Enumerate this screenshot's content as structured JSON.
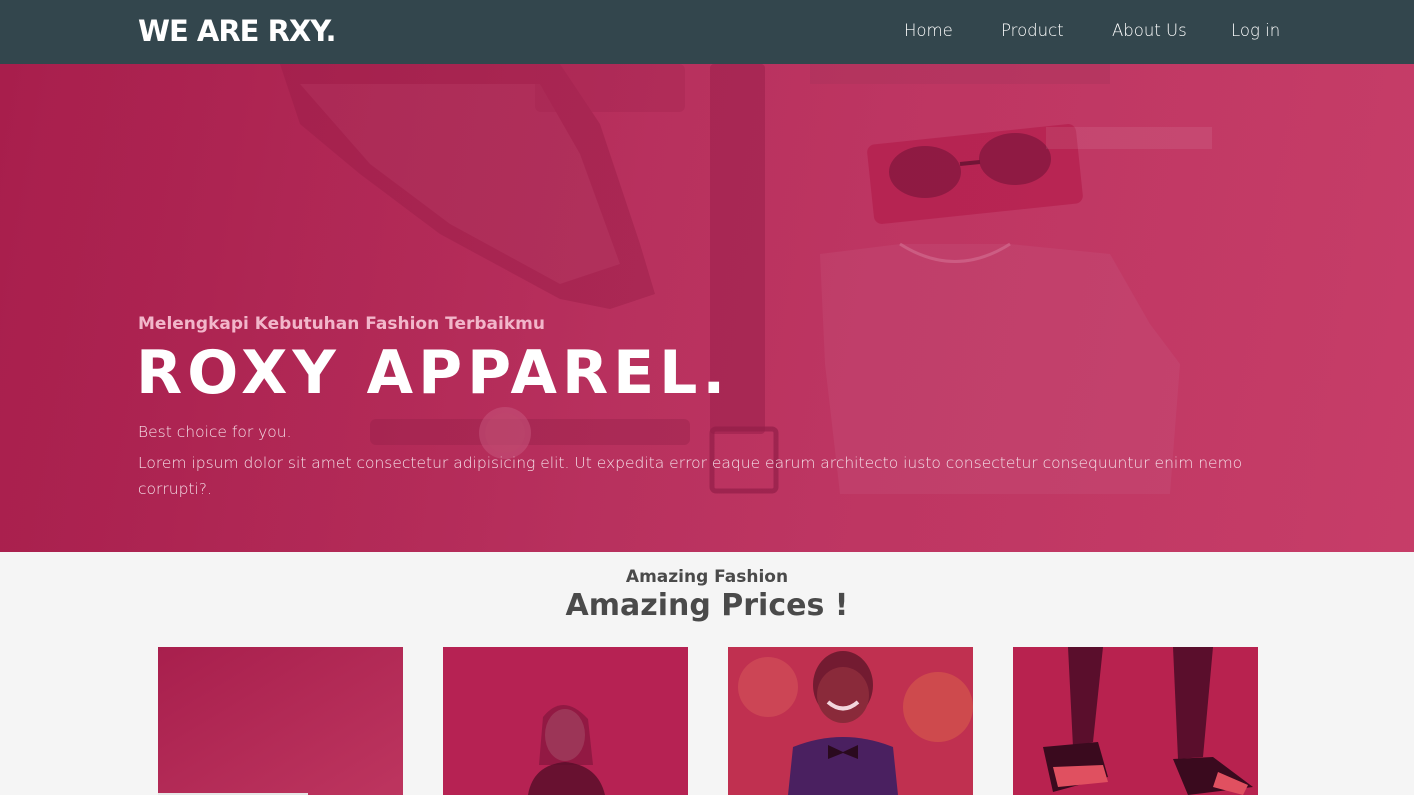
{
  "nav": {
    "brand": "WE ARE RXY.",
    "links": [
      "Home",
      "Product",
      "About Us",
      "Log in"
    ]
  },
  "hero": {
    "tagline": "Melengkapi Kebutuhan Fashion Terbaikmu",
    "title": "ROXY APPAREL.",
    "subtitle": "Best choice for you.",
    "description": "Lorem ipsum dolor sit amet consectetur adipisicing elit. Ut expedita error eaque earum architecto iusto consectetur consequuntur enim nemo corrupti?."
  },
  "section": {
    "kicker": "Amazing Fashion",
    "title": "Amazing Prices !"
  },
  "colors": {
    "navbar": "#33464d",
    "accent": "#b8305e"
  }
}
